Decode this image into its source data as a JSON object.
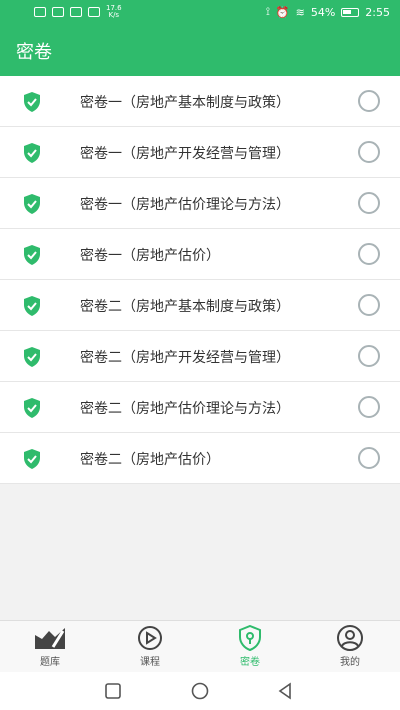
{
  "status": {
    "speed": "17.6\nK/s",
    "battery": "54%",
    "time": "2:55"
  },
  "header": {
    "title": "密卷"
  },
  "papers": [
    {
      "label": "密卷一（房地产基本制度与政策）"
    },
    {
      "label": "密卷一（房地产开发经营与管理）"
    },
    {
      "label": "密卷一（房地产估价理论与方法）"
    },
    {
      "label": "密卷一（房地产估价）"
    },
    {
      "label": "密卷二（房地产基本制度与政策）"
    },
    {
      "label": "密卷二（房地产开发经营与管理）"
    },
    {
      "label": "密卷二（房地产估价理论与方法）"
    },
    {
      "label": "密卷二（房地产估价）"
    }
  ],
  "tabs": [
    {
      "label": "题库",
      "icon": "question-bank-icon"
    },
    {
      "label": "课程",
      "icon": "play-icon"
    },
    {
      "label": "密卷",
      "icon": "shield-icon",
      "active": true
    },
    {
      "label": "我的",
      "icon": "user-icon"
    }
  ],
  "colors": {
    "primary": "#2fbb6c",
    "radio": "#a9b3b6"
  }
}
